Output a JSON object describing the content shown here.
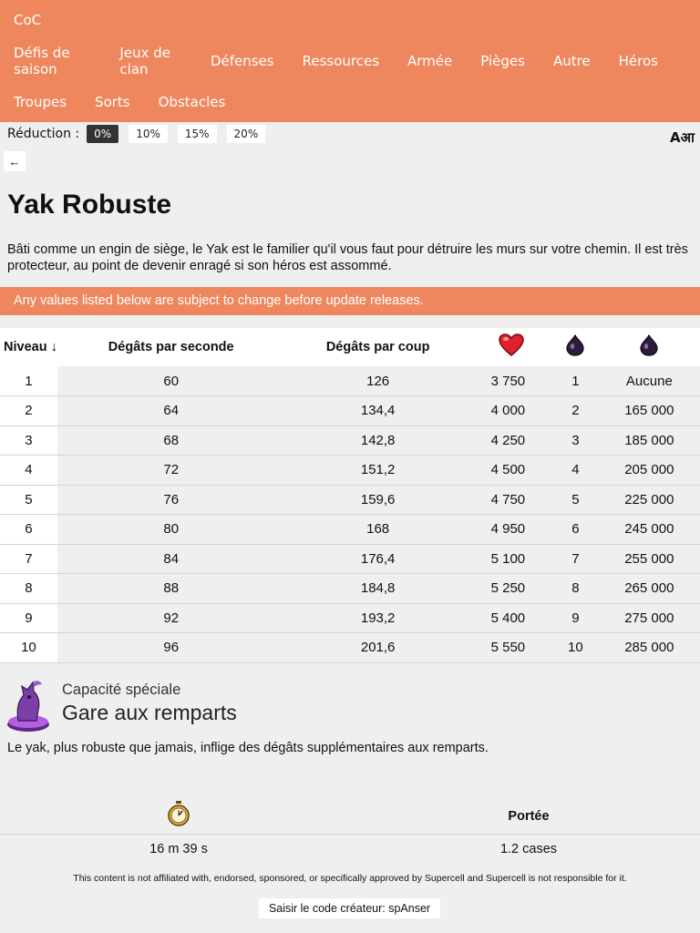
{
  "header": {
    "brand": "CoC",
    "nav_row1": [
      "Défis de saison",
      "Jeux de clan",
      "Défenses",
      "Ressources",
      "Armée",
      "Pièges",
      "Autre",
      "Héros"
    ],
    "nav_row2": [
      "Troupes",
      "Sorts",
      "Obstacles"
    ]
  },
  "reduction": {
    "label": "Réduction :",
    "options": [
      "0%",
      "10%",
      "15%",
      "20%"
    ],
    "selected": "0%"
  },
  "translate_icon": "Aआ",
  "back_button": "←",
  "page": {
    "title": "Yak Robuste",
    "description": "Bâti comme un engin de siège, le Yak est le familier qu'il vous faut pour détruire les murs sur votre chemin. Il est très protecteur, au point de devenir enragé si son héros est assommé.",
    "banner": "Any values listed below are subject to change before update releases."
  },
  "table": {
    "headers": [
      "Niveau ↓",
      "Dégâts par seconde",
      "Dégâts par coup",
      "heart-icon",
      "dark-elixir-icon",
      "dark-elixir-icon"
    ],
    "rows": [
      [
        "1",
        "60",
        "126",
        "3 750",
        "1",
        "Aucune"
      ],
      [
        "2",
        "64",
        "134,4",
        "4 000",
        "2",
        "165 000"
      ],
      [
        "3",
        "68",
        "142,8",
        "4 250",
        "3",
        "185 000"
      ],
      [
        "4",
        "72",
        "151,2",
        "4 500",
        "4",
        "205 000"
      ],
      [
        "5",
        "76",
        "159,6",
        "4 750",
        "5",
        "225 000"
      ],
      [
        "6",
        "80",
        "168",
        "4 950",
        "6",
        "245 000"
      ],
      [
        "7",
        "84",
        "176,4",
        "5 100",
        "7",
        "255 000"
      ],
      [
        "8",
        "88",
        "184,8",
        "5 250",
        "8",
        "265 000"
      ],
      [
        "9",
        "92",
        "193,2",
        "5 400",
        "9",
        "275 000"
      ],
      [
        "10",
        "96",
        "201,6",
        "5 550",
        "10",
        "285 000"
      ]
    ]
  },
  "ability": {
    "caption": "Capacité spéciale",
    "name": "Gare aux remparts",
    "description": "Le yak, plus robuste que jamais, inflige des dégâts supplémentaires aux remparts."
  },
  "meta": {
    "time_icon": "stopwatch-icon",
    "range_label": "Portée",
    "time_value": "16 m 39 s",
    "range_value": "1.2 cases"
  },
  "footer": {
    "disclaimer": "This content is not affiliated with, endorsed, sponsored, or specifically approved by Supercell and Supercell is not responsible for it.",
    "creator_code_button": "Saisir le code créateur: spAnser"
  },
  "colors": {
    "accent": "#ee875e",
    "background": "#efefef",
    "active_chip": "#333333",
    "elixir": "#3a1f4a",
    "ability_purple": "#7b3fa8"
  }
}
